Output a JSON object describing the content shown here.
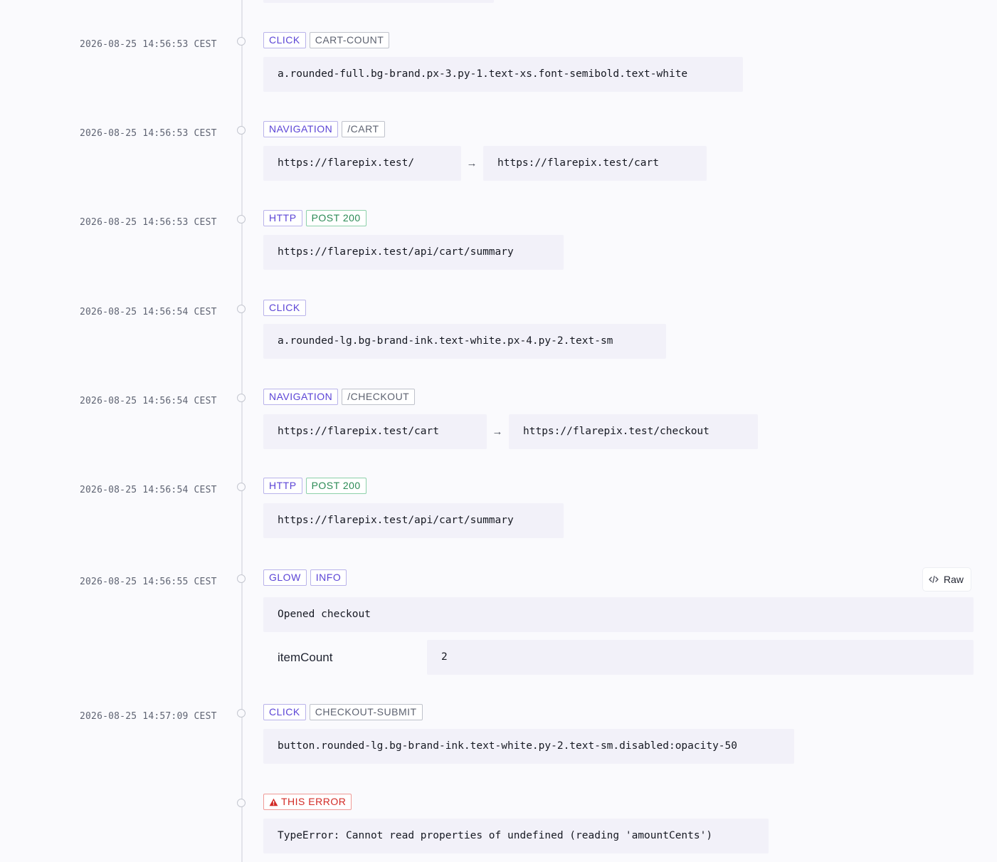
{
  "events": [
    {
      "timestamp": "2026-08-25 14:56:53 CEST",
      "badges": [
        "CLICK",
        "CART-COUNT"
      ],
      "selector": "a.rounded-full.bg-brand.px-3.py-1.text-xs.font-semibold.text-white"
    },
    {
      "timestamp": "2026-08-25 14:56:53 CEST",
      "badges": [
        "NAVIGATION",
        "/CART"
      ],
      "from": "https://flarepix.test/",
      "to": "https://flarepix.test/cart"
    },
    {
      "timestamp": "2026-08-25 14:56:53 CEST",
      "badges": [
        "HTTP",
        "POST 200"
      ],
      "url": "https://flarepix.test/api/cart/summary"
    },
    {
      "timestamp": "2026-08-25 14:56:54 CEST",
      "badges": [
        "CLICK"
      ],
      "selector": "a.rounded-lg.bg-brand-ink.text-white.px-4.py-2.text-sm"
    },
    {
      "timestamp": "2026-08-25 14:56:54 CEST",
      "badges": [
        "NAVIGATION",
        "/CHECKOUT"
      ],
      "from": "https://flarepix.test/cart",
      "to": "https://flarepix.test/checkout"
    },
    {
      "timestamp": "2026-08-25 14:56:54 CEST",
      "badges": [
        "HTTP",
        "POST 200"
      ],
      "url": "https://flarepix.test/api/cart/summary"
    },
    {
      "timestamp": "2026-08-25 14:56:55 CEST",
      "badges": [
        "GLOW",
        "INFO"
      ],
      "raw_label": "Raw",
      "message": "Opened checkout",
      "context_key": "itemCount",
      "context_value": "2"
    },
    {
      "timestamp": "2026-08-25 14:57:09 CEST",
      "badges": [
        "CLICK",
        "CHECKOUT-SUBMIT"
      ],
      "selector": "button.rounded-lg.bg-brand-ink.text-white.py-2.text-sm.disabled:opacity-50"
    },
    {
      "badges": [
        "THIS ERROR"
      ],
      "message": "TypeError: Cannot read properties of undefined (reading 'amountCents')"
    }
  ],
  "icons": {
    "arrow": "→",
    "raw": "code-icon",
    "error": "warning-triangle-icon"
  },
  "colors": {
    "accent": "#5b44d6",
    "success": "#2b8a55",
    "danger": "#d22a25",
    "muted": "#5d6270"
  }
}
